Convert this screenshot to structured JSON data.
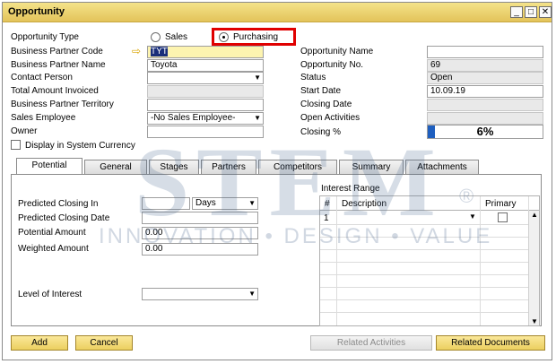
{
  "window": {
    "title": "Opportunity",
    "controls": {
      "minimize": "_",
      "maximize": "□",
      "close": "✕"
    }
  },
  "form": {
    "opportunity_type_label": "Opportunity Type",
    "type_sales": "Sales",
    "type_purchasing": "Purchasing",
    "type_selected": "Purchasing",
    "bp_code_label": "Business Partner Code",
    "bp_code_value": "TYT",
    "bp_name_label": "Business Partner Name",
    "bp_name_value": "Toyota",
    "contact_label": "Contact Person",
    "contact_value": "",
    "total_invoiced_label": "Total Amount Invoiced",
    "total_invoiced_value": "",
    "territory_label": "Business Partner Territory",
    "territory_value": "",
    "sales_employee_label": "Sales Employee",
    "sales_employee_value": "-No Sales Employee-",
    "owner_label": "Owner",
    "owner_value": "",
    "display_currency_label": "Display in System Currency",
    "opp_name_label": "Opportunity Name",
    "opp_name_value": "",
    "opp_no_label": "Opportunity No.",
    "opp_no_value": "69",
    "status_label": "Status",
    "status_value": "Open",
    "start_date_label": "Start Date",
    "start_date_value": "10.09.19",
    "closing_date_label": "Closing Date",
    "closing_date_value": "",
    "open_activities_label": "Open Activities",
    "open_activities_value": "",
    "closing_pct_label": "Closing %",
    "closing_pct_value": "6%",
    "closing_pct_fraction": 0.06
  },
  "tabs": [
    "Potential",
    "General",
    "Stages",
    "Partners",
    "Competitors",
    "Summary",
    "Attachments"
  ],
  "active_tab": "Potential",
  "potential": {
    "pred_closing_in_label": "Predicted Closing In",
    "pred_closing_in_value": "",
    "pred_closing_in_unit": "Days",
    "pred_closing_date_label": "Predicted Closing Date",
    "pred_closing_date_value": "",
    "potential_amount_label": "Potential Amount",
    "potential_amount_value": "0.00",
    "weighted_amount_label": "Weighted Amount",
    "weighted_amount_value": "0.00",
    "level_label": "Level of Interest",
    "level_value": "",
    "interest_range_label": "Interest Range",
    "grid_headers": {
      "num": "#",
      "description": "Description",
      "primary": "Primary"
    },
    "grid_rows": [
      {
        "num": "1",
        "description": "",
        "primary": false
      }
    ]
  },
  "buttons": {
    "add": "Add",
    "cancel": "Cancel",
    "related_activities": "Related Activities",
    "related_documents": "Related Documents"
  },
  "watermark": {
    "main": "STEM",
    "sub": "INNOVATION • DESIGN • VALUE",
    "reg": "®"
  },
  "colors": {
    "title_bar": "#e3c35a",
    "button": "#eccf5f",
    "highlight_box": "#e00000",
    "progress": "#1f5fbf"
  }
}
